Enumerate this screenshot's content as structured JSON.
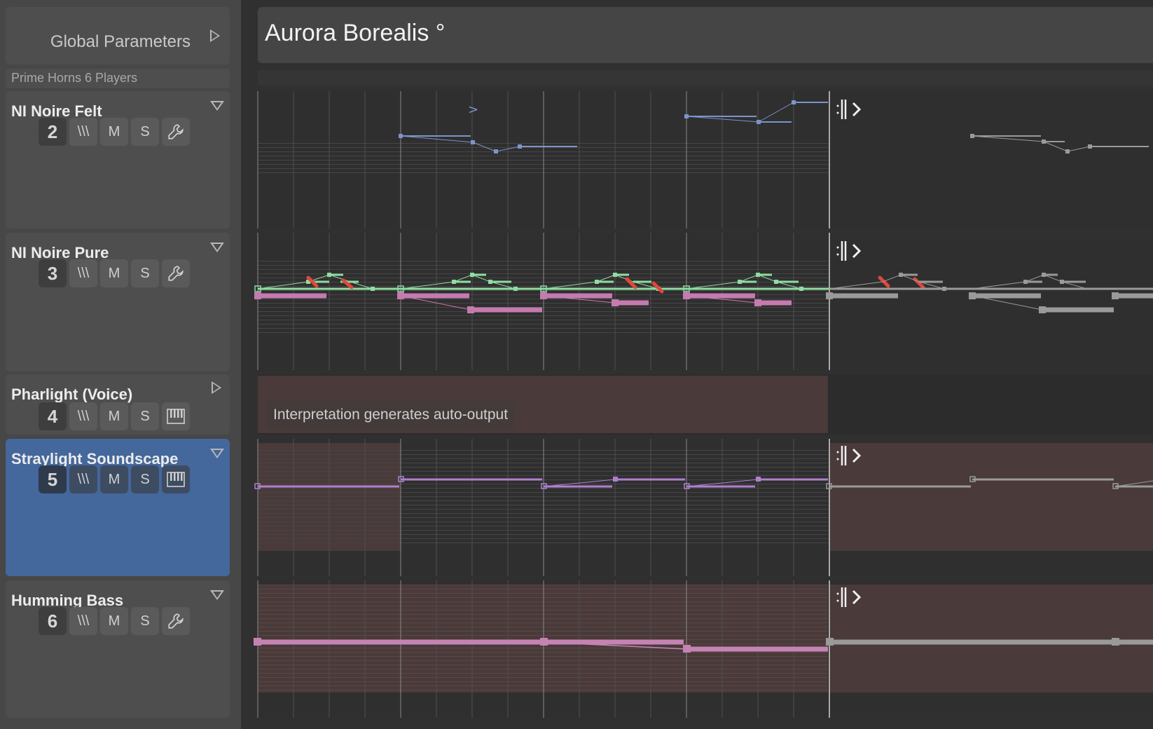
{
  "global": {
    "label": "Global Parameters"
  },
  "ensemble": {
    "label": "Prime Horns 6 Players"
  },
  "song": {
    "title": "Aurora Borealis °"
  },
  "tracks": [
    {
      "name": "NI Noire Felt",
      "number": "2",
      "tool_icon": "wrench-icon",
      "expand": "collapse"
    },
    {
      "name": "NI Noire Pure",
      "number": "3",
      "tool_icon": "wrench-icon",
      "expand": "collapse"
    },
    {
      "name": "Pharlight (Voice)",
      "number": "4",
      "tool_icon": "piano-keys-icon",
      "expand": "expand"
    },
    {
      "name": "Straylight Soundscape",
      "number": "5",
      "tool_icon": "piano-keys-icon",
      "expand": "collapse",
      "selected": true
    },
    {
      "name": "Humming Bass",
      "number": "6",
      "tool_icon": "wrench-icon",
      "expand": "collapse"
    }
  ],
  "buttons": {
    "arp": "\\\\\\",
    "mute": "M",
    "solo": "S"
  },
  "banner": {
    "text": "Interpretation generates auto-output"
  },
  "colors": {
    "selected_track": "#44679c",
    "felt_notes": "#7b95c9",
    "pure_upper_notes": "#8fdca0",
    "pure_lower_notes": "#c57ab0",
    "accent_marks": "#e0473a",
    "soundscape_notes": "#b07fcf",
    "bass_notes": "#c583b3",
    "loop_notes": "#9a9a9a",
    "auto_output_bg": "#4a3a3a"
  }
}
